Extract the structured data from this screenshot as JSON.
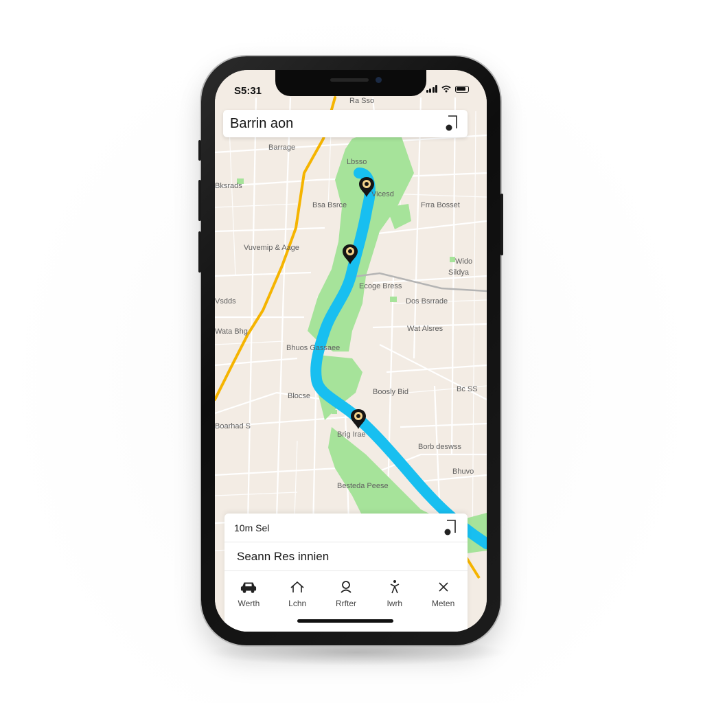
{
  "status_bar": {
    "time": "S5:31"
  },
  "search": {
    "text": "Barrin aon",
    "icon": "map-pin-icon"
  },
  "map": {
    "labels": [
      "Ra Sso",
      "Barrage",
      "Lbsso",
      "Bksrads",
      "Vicesd",
      "Bsa Bsrce",
      "Frra Bosset",
      "Vuvemip & Aage",
      "Wido",
      "Sildya",
      "Ecoge Bress",
      "Dos Bsrrade",
      "Vsdds",
      "Wat Alsres",
      "Wata Bhg",
      "Bhuos Gassaee",
      "Blocse",
      "Boosly Bid",
      "Bc SS",
      "Boarhad S",
      "Brig Irae",
      "Borb deswss",
      "Besteda Peese",
      "Bhuvo"
    ],
    "markers": 3,
    "colors": {
      "river": "#18bff0",
      "park": "#a6e39a",
      "land": "#f3ece4",
      "road_major": "#f5b400",
      "road_minor": "#ffffff",
      "rail": "#b4b4b4"
    }
  },
  "sheet": {
    "row1": "10m Sel",
    "row1_icon": "map-pin-icon",
    "row2": "Seann Res innien"
  },
  "tabs": [
    {
      "label": "Werth",
      "icon": "car-icon"
    },
    {
      "label": "Lchn",
      "icon": "home-icon"
    },
    {
      "label": "Rrfter",
      "icon": "person-icon"
    },
    {
      "label": "Iwrh",
      "icon": "walk-icon"
    },
    {
      "label": "Meten",
      "icon": "close-icon"
    }
  ]
}
